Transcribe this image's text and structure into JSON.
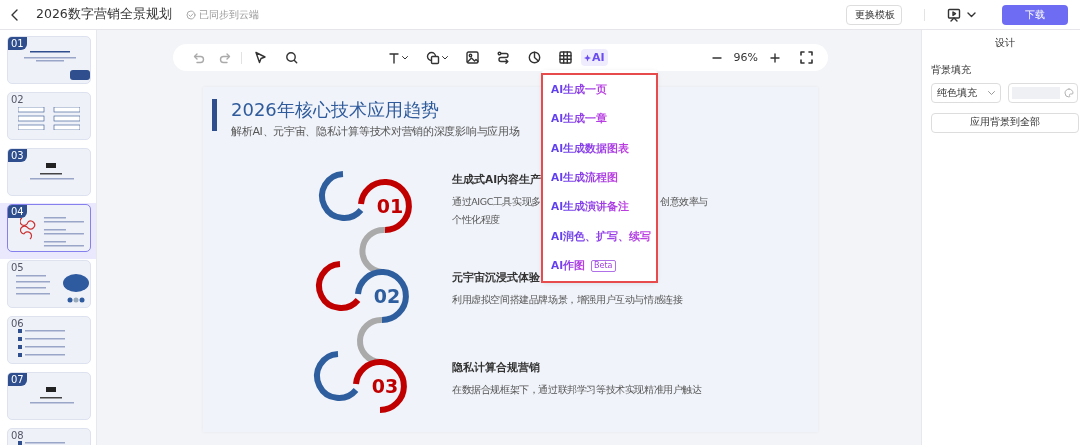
{
  "top_bar": {
    "title": "2026数字营销全景规划",
    "sync_status": "已同步到云端",
    "buttons": [
      {
        "label": "更换模板",
        "kind": "outline"
      },
      {
        "label": "下载",
        "kind": "primary"
      }
    ]
  },
  "slides": [
    {
      "number": "01",
      "kind": "cover",
      "selected": false
    },
    {
      "number": "02",
      "kind": "list",
      "selected": false
    },
    {
      "number": "03",
      "kind": "section",
      "selected": false
    },
    {
      "number": "04",
      "kind": "steps",
      "selected": true
    },
    {
      "number": "05",
      "kind": "brain",
      "selected": false
    },
    {
      "number": "06",
      "kind": "bullets",
      "selected": false
    },
    {
      "number": "07",
      "kind": "section",
      "selected": false
    },
    {
      "number": "08",
      "kind": "bullets",
      "selected": false
    }
  ],
  "toolbar": {
    "ai_label": "AI",
    "zoom": "96%"
  },
  "slide": {
    "title": "2026年核心技术应用趋势",
    "subtitle": "解析AI、元宇宙、隐私计算等技术对营销的深度影响与应用场",
    "items": [
      {
        "number": "01",
        "color": "#c00000",
        "heading": "生成式AI内容生产",
        "lines": [
          [
            "通过AIGC工具实现多",
            "创意效率与"
          ],
          [
            "个性化程度"
          ]
        ]
      },
      {
        "number": "02",
        "color": "#2e5e9e",
        "heading": "元宇宙沉浸式体验",
        "lines": [
          [
            "利用虚拟空间搭建品牌场景，增强用户互动与情感连接"
          ]
        ]
      },
      {
        "number": "03",
        "color": "#c00000",
        "heading": "隐私计算合规营销",
        "lines": [
          [
            "在数据合规框架下，通过联邦学习等技术实现精准用户触达"
          ]
        ]
      }
    ]
  },
  "ai_menu": {
    "items": [
      {
        "label": "AI生成一页"
      },
      {
        "label": "AI生成一章"
      },
      {
        "label": "AI生成数据图表"
      },
      {
        "label": "AI生成流程图"
      },
      {
        "label": "AI生成演讲备注"
      },
      {
        "label": "AI润色、扩写、续写"
      },
      {
        "label": "AI作图",
        "badge": "Beta"
      }
    ]
  },
  "design_panel": {
    "title": "设计",
    "section": "背景填充",
    "fill_type": "纯色填充",
    "apply_button": "应用背景到全部"
  }
}
